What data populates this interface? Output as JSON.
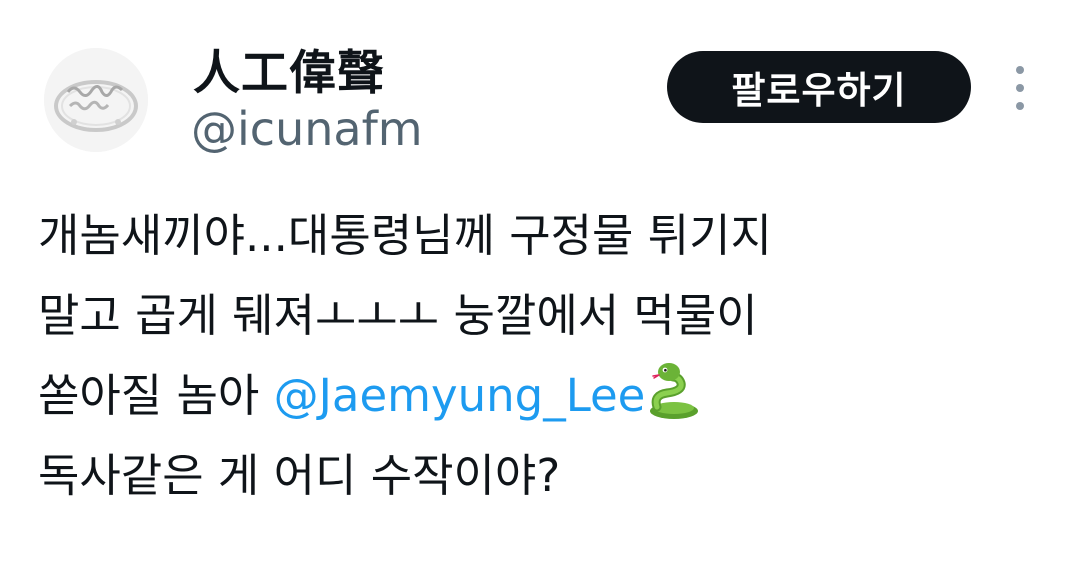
{
  "user": {
    "display_name": "人工偉聲",
    "handle": "@icunafm",
    "avatar_icon": "ring-photo-avatar"
  },
  "actions": {
    "follow_label": "팔로우하기",
    "more_icon": "more-vertical-icon"
  },
  "tweet": {
    "line1": "개놈새끼야...대통령님께 구정물 튀기지",
    "line2": "말고 곱게 뒈져ㅗㅗㅗ 눙깔에서 먹물이",
    "line3_text": "쏟아질 놈아 ",
    "line3_mention": "@Jaemyung_Lee",
    "line3_emoji": "snake-emoji",
    "line4": "독사같은 게 어디 수작이야?"
  },
  "colors": {
    "text": "#0f1419",
    "secondary": "#536471",
    "link": "#1d9bf0",
    "button_bg": "#0f1419",
    "button_text": "#ffffff"
  }
}
